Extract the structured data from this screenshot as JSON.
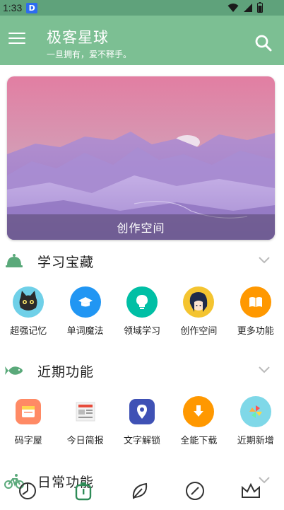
{
  "status": {
    "time": "1:33",
    "badge": "D"
  },
  "appbar": {
    "title": "极客星球",
    "subtitle": "一旦拥有，爱不释手。"
  },
  "banner": {
    "caption": "创作空间"
  },
  "sections": [
    {
      "title": "学习宝藏",
      "icon": "bell-icon",
      "items": [
        {
          "label": "超强记忆",
          "icon": "cat-avatar-icon",
          "color": "#6fd0e8"
        },
        {
          "label": "单词魔法",
          "icon": "graduation-cap-icon",
          "color": "#2196f3"
        },
        {
          "label": "领域学习",
          "icon": "lightbulb-icon",
          "color": "#00bfa5"
        },
        {
          "label": "创作空间",
          "icon": "girl-avatar-icon",
          "color": "#f4c430"
        },
        {
          "label": "更多功能",
          "icon": "book-icon",
          "color": "#ff9800"
        }
      ]
    },
    {
      "title": "近期功能",
      "icon": "fish-icon",
      "items": [
        {
          "label": "码字屋",
          "icon": "note-icon",
          "color": "#ff8a65"
        },
        {
          "label": "今日简报",
          "icon": "newspaper-icon",
          "color": "#ffffff"
        },
        {
          "label": "文字解锁",
          "icon": "lock-pin-icon",
          "color": "#3f51b5"
        },
        {
          "label": "全能下载",
          "icon": "download-icon",
          "color": "#ff9800"
        },
        {
          "label": "近期新增",
          "icon": "pinwheel-icon",
          "color": "#7fd8e8"
        }
      ]
    },
    {
      "title": "日常功能",
      "icon": "bicycle-icon"
    }
  ],
  "bottom_nav": [
    "clock-icon",
    "timer-icon",
    "leaf-icon",
    "compass-icon",
    "crown-icon"
  ],
  "colors": {
    "statusbar": "#5fa27b",
    "appbar": "#7cbf93",
    "accent": "#5aa97a"
  }
}
